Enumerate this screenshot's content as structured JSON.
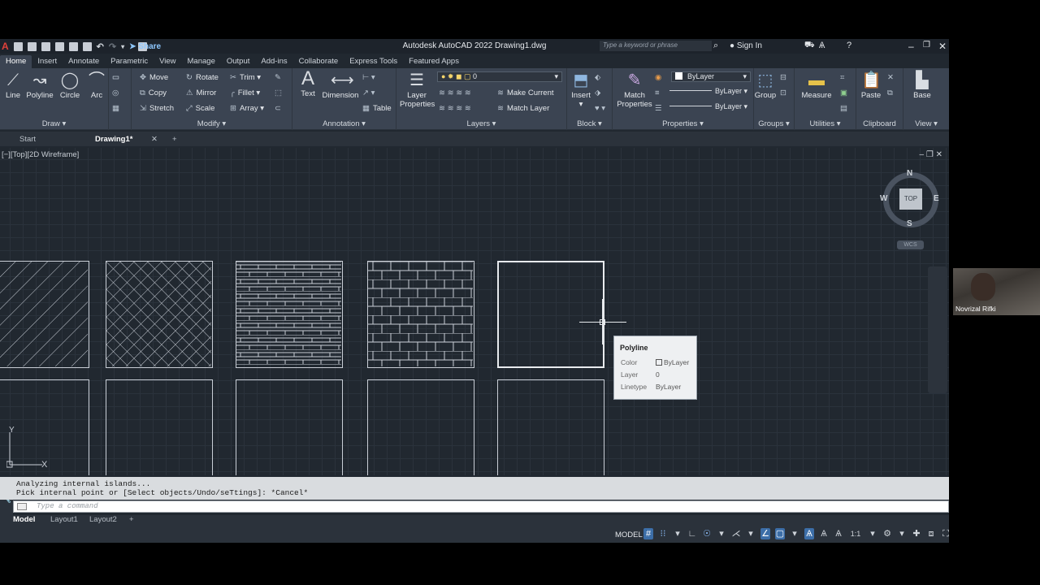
{
  "title_bar": {
    "title": "Autodesk AutoCAD 2022   Drawing1.dwg",
    "share_label": "Share",
    "search_placeholder": "Type a keyword or phrase",
    "signin_label": "Sign In",
    "app_logo": "A"
  },
  "ribbon_tabs": [
    "Home",
    "Insert",
    "Annotate",
    "Parametric",
    "View",
    "Manage",
    "Output",
    "Add-ins",
    "Collaborate",
    "Express Tools",
    "Featured Apps"
  ],
  "ribbon": {
    "draw": {
      "title": "Draw",
      "line": "Line",
      "polyline": "Polyline",
      "circle": "Circle",
      "arc": "Arc"
    },
    "modify": {
      "title": "Modify",
      "move": "Move",
      "rotate": "Rotate",
      "trim": "Trim",
      "copy": "Copy",
      "mirror": "Mirror",
      "fillet": "Fillet",
      "stretch": "Stretch",
      "scale": "Scale",
      "array": "Array"
    },
    "annotation": {
      "title": "Annotation",
      "text": "Text",
      "dimension": "Dimension",
      "table": "Table"
    },
    "layers": {
      "title": "Layers",
      "layer_properties": "Layer Properties",
      "current_layer": "0",
      "make_current": "Make Current",
      "match_layer": "Match Layer"
    },
    "block": {
      "title": "Block",
      "insert": "Insert"
    },
    "properties": {
      "title": "Properties",
      "match_properties": "Match Properties",
      "color": "ByLayer",
      "linetype": "ByLayer",
      "lineweight": "ByLayer"
    },
    "groups": {
      "title": "Groups",
      "group": "Group"
    },
    "utilities": {
      "title": "Utilities",
      "measure": "Measure"
    },
    "clipboard": {
      "title": "Clipboard",
      "paste": "Paste"
    },
    "view": {
      "title": "View",
      "base": "Base"
    }
  },
  "file_tabs": {
    "start": "Start",
    "drawing": "Drawing1*"
  },
  "viewport_label": "[−][Top][2D Wireframe]",
  "viewcube": {
    "top": "TOP",
    "n": "N",
    "s": "S",
    "e": "E",
    "w": "W",
    "wcs": "WCS"
  },
  "tooltip": {
    "header": "Polyline",
    "color_key": "Color",
    "color_val": "ByLayer",
    "layer_key": "Layer",
    "layer_val": "0",
    "linetype_key": "Linetype",
    "linetype_val": "ByLayer"
  },
  "command_history": [
    "Analyzing internal islands...",
    "Pick internal point or [Select objects/Undo/seTtings]: *Cancel*"
  ],
  "command_placeholder": "Type a command",
  "layout_tabs": [
    "Model",
    "Layout1",
    "Layout2"
  ],
  "status": {
    "model": "MODEL",
    "scale": "1:1"
  },
  "webcam": {
    "name": "Novrizal Rifki"
  },
  "icons": [
    "line-icon",
    "polyline-icon",
    "circle-icon",
    "arc-icon",
    "move-icon",
    "rotate-icon",
    "trim-icon",
    "copy-icon",
    "mirror-icon",
    "fillet-icon",
    "stretch-icon",
    "scale-icon",
    "array-icon",
    "text-icon",
    "dimension-icon",
    "table-icon",
    "layer-properties-icon",
    "insert-icon",
    "match-properties-icon",
    "group-icon",
    "measure-icon",
    "paste-icon",
    "base-icon",
    "close-icon",
    "plus-icon",
    "search-icon",
    "user-icon",
    "help-icon",
    "wrench-icon",
    "grid-icon",
    "snap-icon",
    "ortho-icon",
    "polar-icon",
    "osnap-icon",
    "gear-icon",
    "menu-icon"
  ],
  "colors": {
    "canvas": "#212830",
    "ribbon": "#3b4452",
    "grid": "#2a323c",
    "accent": "#3c6ea8",
    "logo": "#e0413a",
    "hatch": "#c9ced6"
  }
}
